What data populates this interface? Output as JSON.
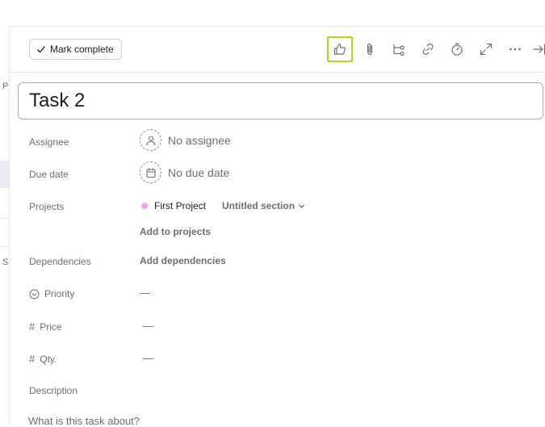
{
  "left_strip": {
    "fragment_top": "P",
    "fragment_bottom": "S"
  },
  "toolbar": {
    "mark_complete_label": "Mark complete",
    "icons": [
      "thumbs-up-icon",
      "paperclip-icon",
      "subtask-icon",
      "link-icon",
      "timer-icon",
      "expand-icon",
      "more-icon",
      "close-panel-icon"
    ]
  },
  "task": {
    "title": "Task 2"
  },
  "fields": {
    "assignee": {
      "label": "Assignee",
      "value": "No assignee"
    },
    "due_date": {
      "label": "Due date",
      "value": "No due date"
    },
    "projects": {
      "label": "Projects",
      "project_name": "First Project",
      "project_color": "#f1a7e6",
      "section": "Untitled section",
      "add_label": "Add to projects"
    },
    "dependencies": {
      "label": "Dependencies",
      "add_label": "Add dependencies"
    },
    "priority": {
      "label": "Priority",
      "value": "—"
    },
    "price": {
      "label": "Price",
      "value": "—"
    },
    "qty": {
      "label": "Qty.",
      "value": "—"
    },
    "description": {
      "label": "Description",
      "placeholder": "What is this task about?"
    }
  },
  "colors": {
    "focus_ring": "#b7d21c",
    "text": "#1e1f21",
    "muted": "#6d6e6f"
  }
}
